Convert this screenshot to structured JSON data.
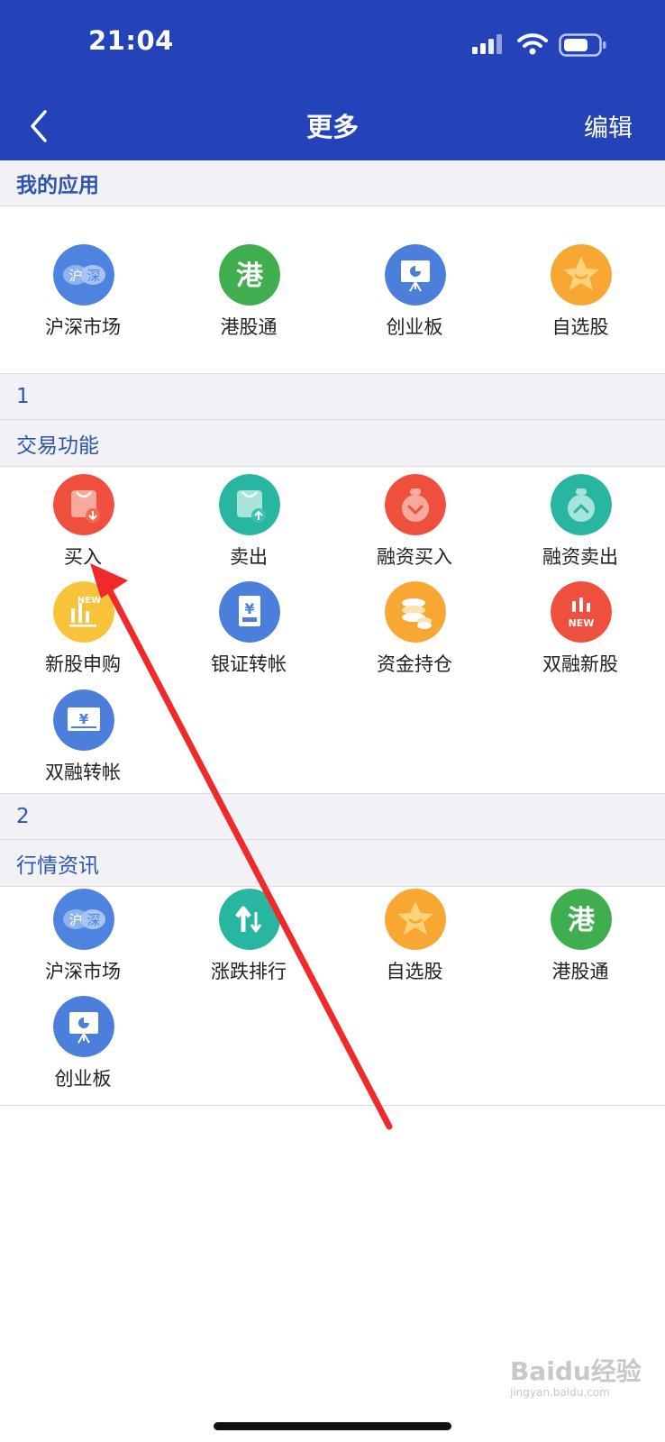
{
  "status_bar": {
    "time": "21:04"
  },
  "nav": {
    "title": "更多",
    "edit_label": "编辑"
  },
  "my_apps": {
    "title": "我的应用",
    "items": [
      {
        "label": "沪深市场",
        "icon": "hushen-icon",
        "badge1": "沪",
        "badge2": "深"
      },
      {
        "label": "港股通",
        "icon": "hk-connect-icon",
        "glyph": "港"
      },
      {
        "label": "创业板",
        "icon": "chinext-board-icon"
      },
      {
        "label": "自选股",
        "icon": "star-icon"
      }
    ]
  },
  "group1": {
    "number": "1",
    "title": "交易功能"
  },
  "trade": {
    "items": [
      {
        "label": "买入",
        "icon": "buy-bag-icon"
      },
      {
        "label": "卖出",
        "icon": "sell-bag-icon"
      },
      {
        "label": "融资买入",
        "icon": "margin-buy-icon"
      },
      {
        "label": "融资卖出",
        "icon": "margin-sell-icon"
      },
      {
        "label": "新股申购",
        "icon": "ipo-subscribe-icon",
        "badge": "NEW"
      },
      {
        "label": "银证转帐",
        "icon": "bank-transfer-icon",
        "glyph": "¥"
      },
      {
        "label": "资金持仓",
        "icon": "coins-icon"
      },
      {
        "label": "双融新股",
        "icon": "margin-ipo-icon",
        "badge": "NEW"
      },
      {
        "label": "双融转帐",
        "icon": "margin-transfer-icon",
        "glyph": "¥"
      }
    ]
  },
  "group2": {
    "number": "2",
    "title": "行情资讯"
  },
  "market": {
    "items": [
      {
        "label": "沪深市场",
        "icon": "hushen-icon",
        "badge1": "沪",
        "badge2": "深"
      },
      {
        "label": "涨跌排行",
        "icon": "up-down-ranking-icon"
      },
      {
        "label": "自选股",
        "icon": "star-icon"
      },
      {
        "label": "港股通",
        "icon": "hk-connect-icon",
        "glyph": "港"
      },
      {
        "label": "创业板",
        "icon": "chinext-board-icon"
      }
    ]
  },
  "watermark": {
    "text": "Baidu经验",
    "sub": "jingyan.baidu.com"
  },
  "colors": {
    "header": "#2443b8",
    "section_text": "#2f55b0",
    "annotation_arrow": "#f02a2a"
  }
}
